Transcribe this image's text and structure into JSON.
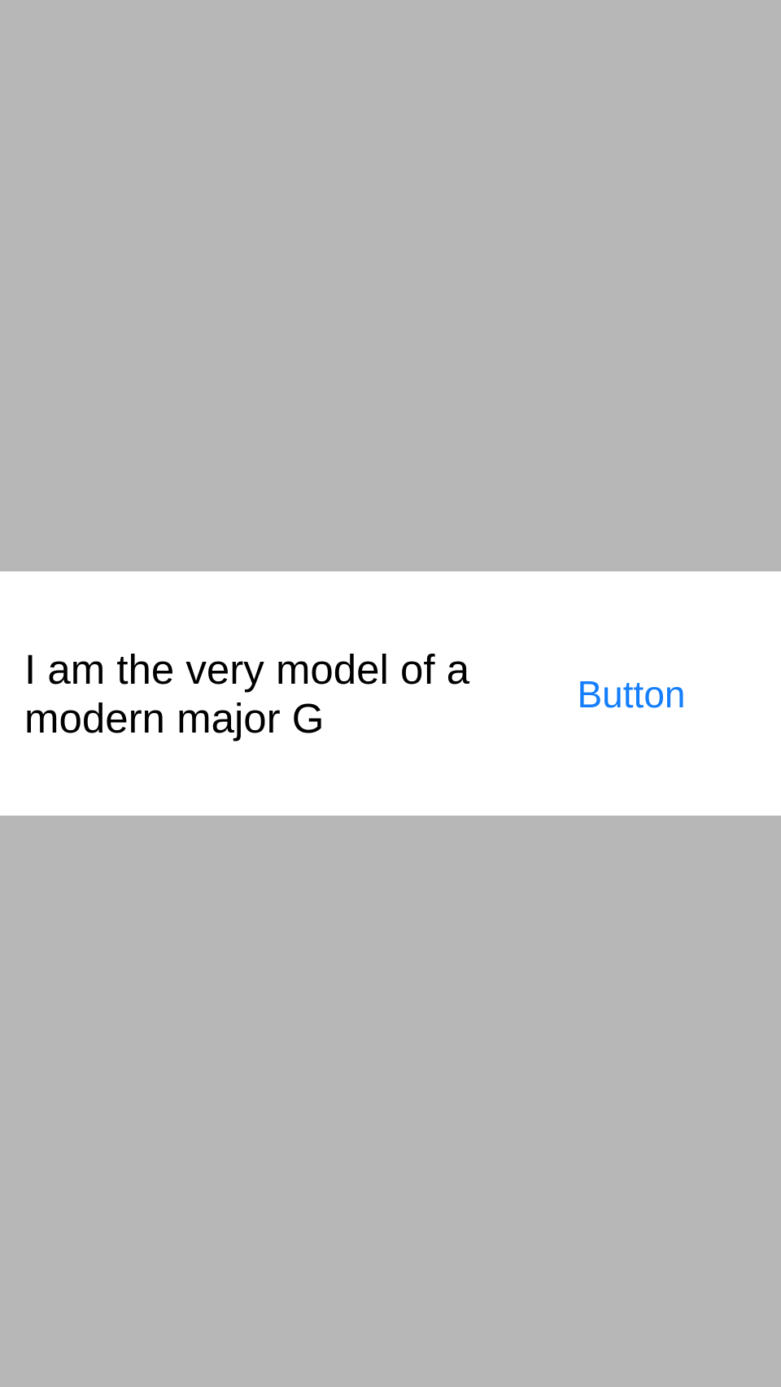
{
  "colors": {
    "background": "#b7b7b7",
    "cell_background": "#ffffff",
    "text": "#000000",
    "button_text": "#147efb"
  },
  "cell": {
    "text": "I am the very model of a modern major G",
    "button_label": "Button"
  }
}
